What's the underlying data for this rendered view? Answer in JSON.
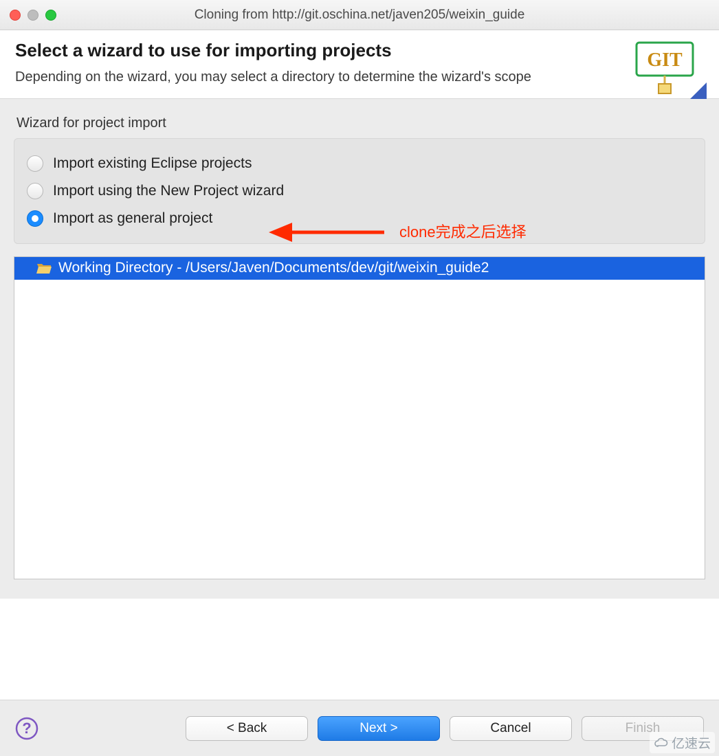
{
  "window": {
    "title": "Cloning from http://git.oschina.net/javen205/weixin_guide"
  },
  "header": {
    "title": "Select a wizard to use for importing projects",
    "subtitle": "Depending on the wizard, you may select a directory to determine the wizard's scope",
    "logo_text": "GIT"
  },
  "wizard": {
    "group_label": "Wizard for project import",
    "options": [
      {
        "label": "Import existing Eclipse projects",
        "checked": false
      },
      {
        "label": "Import using the New Project wizard",
        "checked": false
      },
      {
        "label": "Import as general project",
        "checked": true
      }
    ]
  },
  "annotation": {
    "text": "clone完成之后选择"
  },
  "tree": {
    "selected_label": "Working Directory - /Users/Javen/Documents/dev/git/weixin_guide2"
  },
  "footer": {
    "back": "< Back",
    "next": "Next >",
    "cancel": "Cancel",
    "finish": "Finish"
  },
  "watermark": "亿速云"
}
